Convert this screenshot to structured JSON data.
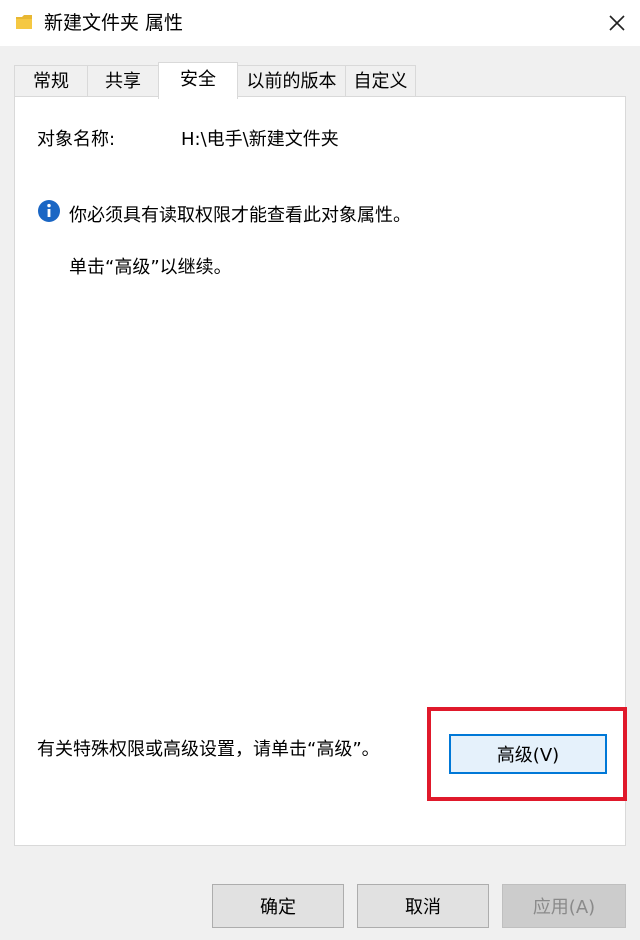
{
  "window": {
    "title": "新建文件夹 属性",
    "icon": "folder-icon",
    "close_icon": "close-icon"
  },
  "tabs": [
    {
      "label": "常规"
    },
    {
      "label": "共享"
    },
    {
      "label": "安全",
      "active": true
    },
    {
      "label": "以前的版本"
    },
    {
      "label": "自定义"
    }
  ],
  "security": {
    "object_name_label": "对象名称:",
    "object_name_value": "H:\\电手\\新建文件夹",
    "info_icon": "info-icon",
    "info_message": "你必须具有读取权限才能查看此对象属性。",
    "continue_message": "单击“高级”以继续。",
    "advanced_description": "有关特殊权限或高级设置，请单击“高级”。",
    "advanced_button": "高级(V)",
    "highlight_color": "#e0192b"
  },
  "footer": {
    "ok": "确定",
    "cancel": "取消",
    "apply": "应用(A)",
    "apply_disabled": true
  },
  "colors": {
    "accent": "#0078d7",
    "info_blue": "#1a66c4",
    "folder_yellow": "#e8b732"
  }
}
